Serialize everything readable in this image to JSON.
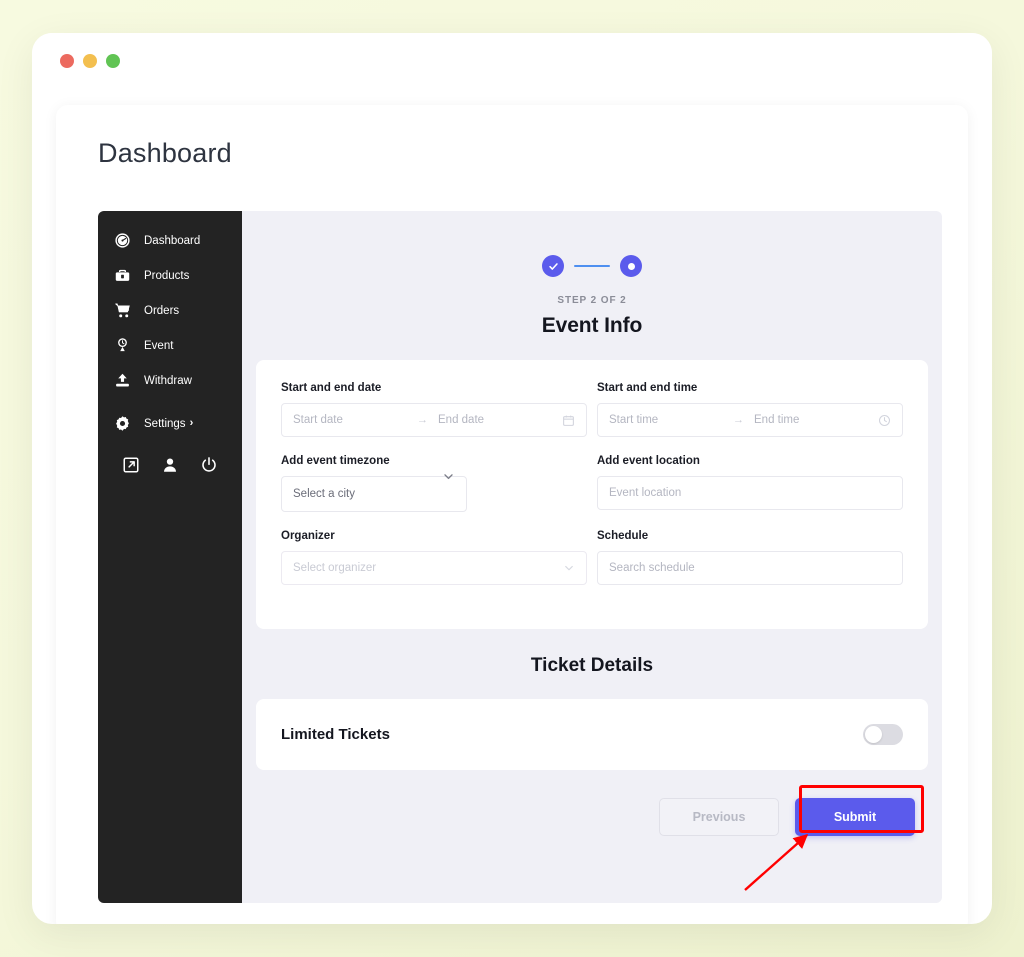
{
  "window": {
    "traffic_lights": [
      "close",
      "minimize",
      "maximize"
    ],
    "colors": {
      "close": "#ec6a5f",
      "minimize": "#f3bf4f",
      "maximize": "#61c454"
    }
  },
  "page": {
    "title": "Dashboard"
  },
  "sidebar": {
    "items": [
      {
        "label": "Dashboard",
        "icon": "gauge-icon"
      },
      {
        "label": "Products",
        "icon": "briefcase-icon"
      },
      {
        "label": "Orders",
        "icon": "cart-icon"
      },
      {
        "label": "Event",
        "icon": "event-pin-icon"
      },
      {
        "label": "Withdraw",
        "icon": "upload-icon"
      },
      {
        "label": "Settings",
        "icon": "gear-icon",
        "chevron": "›"
      }
    ],
    "bottom_icons": [
      {
        "name": "external-link-icon"
      },
      {
        "name": "user-icon"
      },
      {
        "name": "power-icon"
      }
    ]
  },
  "stepper": {
    "step_1_state": "completed",
    "step_2_state": "current",
    "accent_color": "#5b5bec",
    "line_color": "#4e8ff0",
    "caption": "STEP 2 OF 2",
    "heading": "Event Info"
  },
  "form": {
    "date_range": {
      "label": "Start and end date",
      "start_placeholder": "Start date",
      "end_placeholder": "End date",
      "separator": "→",
      "icon": "calendar-icon"
    },
    "time_range": {
      "label": "Start and end time",
      "start_placeholder": "Start time",
      "end_placeholder": "End time",
      "separator": "→",
      "icon": "clock-icon"
    },
    "timezone": {
      "label": "Add event timezone",
      "value": "Select a city",
      "icon": "chevron-down-icon"
    },
    "location": {
      "label": "Add event location",
      "placeholder": "Event location"
    },
    "organizer": {
      "label": "Organizer",
      "placeholder": "Select organizer",
      "icon": "chevron-down-icon"
    },
    "schedule": {
      "label": "Schedule",
      "placeholder": "Search schedule"
    }
  },
  "tickets": {
    "section_heading": "Ticket Details",
    "limited_label": "Limited Tickets",
    "limited_enabled": false
  },
  "footer": {
    "previous_label": "Previous",
    "submit_label": "Submit"
  },
  "annotation": {
    "color": "#ff0000",
    "target": "submit-button"
  }
}
